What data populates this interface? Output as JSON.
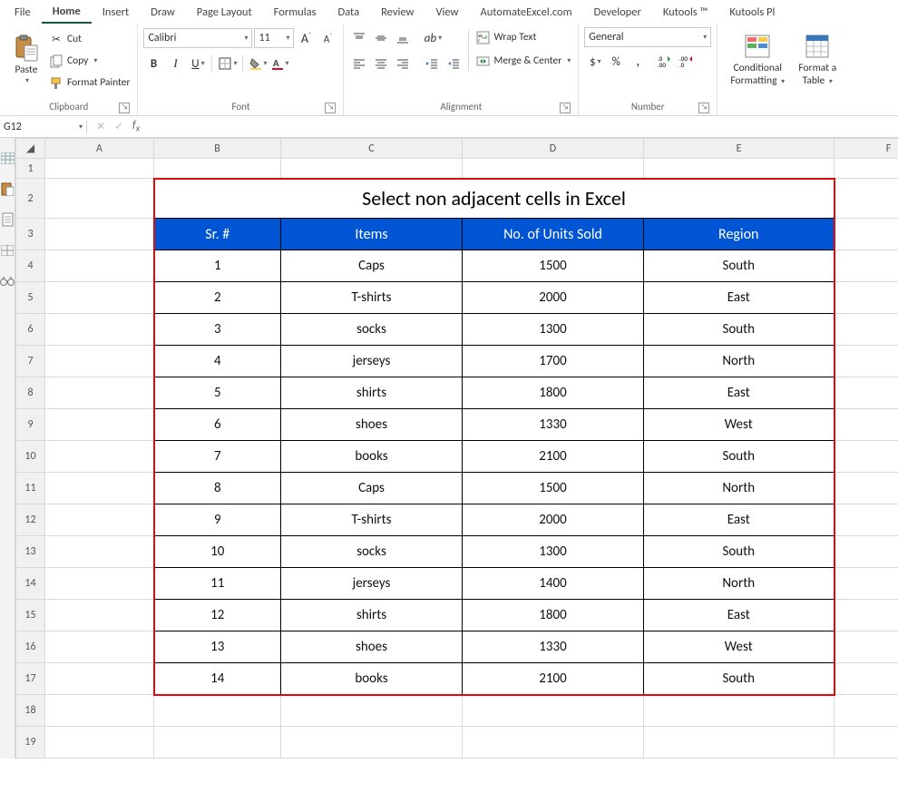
{
  "tabs": {
    "file": "File",
    "home": "Home",
    "insert": "Insert",
    "draw": "Draw",
    "page_layout": "Page Layout",
    "formulas": "Formulas",
    "data": "Data",
    "review": "Review",
    "view": "View",
    "automate": "AutomateExcel.com",
    "developer": "Developer",
    "kutools": "Kutools ™",
    "kutools_plus": "Kutools Pl"
  },
  "ribbon": {
    "clipboard": {
      "paste": "Paste",
      "cut": "Cut",
      "copy": "Copy",
      "format_painter": "Format Painter",
      "label": "Clipboard"
    },
    "font": {
      "font_name": "Calibri",
      "font_size": "11",
      "bold": "B",
      "italic": "I",
      "underline": "U",
      "label": "Font"
    },
    "alignment": {
      "wrap": "Wrap Text",
      "merge": "Merge & Center",
      "label": "Alignment"
    },
    "number": {
      "format": "General",
      "label": "Number"
    },
    "styles": {
      "cond": "Conditional",
      "cond2": "Formatting",
      "fmt": "Format a",
      "fmt2": "Table"
    }
  },
  "namebox": "G12",
  "columns": [
    "A",
    "B",
    "C",
    "D",
    "E",
    "F"
  ],
  "row_numbers": [
    "1",
    "2",
    "3",
    "4",
    "5",
    "6",
    "7",
    "8",
    "9",
    "10",
    "11",
    "12",
    "13",
    "14",
    "15",
    "16",
    "17",
    "18",
    "19"
  ],
  "table": {
    "title": "Select non adjacent cells in Excel",
    "headers": {
      "sr": "Sr. #",
      "items": "Items",
      "units": "No. of Units Sold",
      "region": "Region"
    },
    "rows": [
      {
        "sr": "1",
        "items": "Caps",
        "units": "1500",
        "region": "South"
      },
      {
        "sr": "2",
        "items": "T-shirts",
        "units": "2000",
        "region": "East"
      },
      {
        "sr": "3",
        "items": "socks",
        "units": "1300",
        "region": "South"
      },
      {
        "sr": "4",
        "items": "jerseys",
        "units": "1700",
        "region": "North"
      },
      {
        "sr": "5",
        "items": "shirts",
        "units": "1800",
        "region": "East"
      },
      {
        "sr": "6",
        "items": "shoes",
        "units": "1330",
        "region": "West"
      },
      {
        "sr": "7",
        "items": "books",
        "units": "2100",
        "region": "South"
      },
      {
        "sr": "8",
        "items": "Caps",
        "units": "1500",
        "region": "North"
      },
      {
        "sr": "9",
        "items": "T-shirts",
        "units": "2000",
        "region": "East"
      },
      {
        "sr": "10",
        "items": "socks",
        "units": "1300",
        "region": "South"
      },
      {
        "sr": "11",
        "items": "jerseys",
        "units": "1400",
        "region": "North"
      },
      {
        "sr": "12",
        "items": "shirts",
        "units": "1800",
        "region": "East"
      },
      {
        "sr": "13",
        "items": "shoes",
        "units": "1330",
        "region": "West"
      },
      {
        "sr": "14",
        "items": "books",
        "units": "2100",
        "region": "South"
      }
    ]
  }
}
